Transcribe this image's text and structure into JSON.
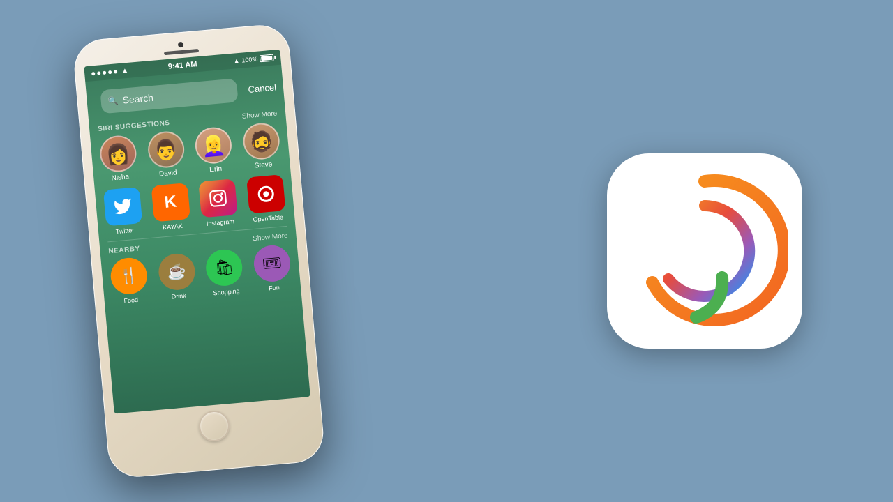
{
  "background_color": "#7a9cb8",
  "phone": {
    "status_bar": {
      "time": "9:41 AM",
      "battery": "100%",
      "signal": "●●●●●",
      "wifi": "WiFi"
    },
    "search": {
      "placeholder": "Search",
      "cancel_label": "Cancel"
    },
    "siri_suggestions": {
      "section_title": "SIRI SUGGESTIONS",
      "show_more": "Show More",
      "contacts": [
        {
          "name": "Nisha",
          "emoji": "👩",
          "bg": "#d4956a"
        },
        {
          "name": "David",
          "emoji": "👨",
          "bg": "#c8a87a"
        },
        {
          "name": "Erin",
          "emoji": "👱‍♀️",
          "bg": "#b8956a"
        },
        {
          "name": "Steve",
          "emoji": "🧔",
          "bg": "#c89870"
        }
      ],
      "apps": [
        {
          "name": "Twitter",
          "icon": "🐦",
          "bg_class": "app-twitter"
        },
        {
          "name": "KAYAK",
          "icon": "K",
          "bg_class": "app-kayak"
        },
        {
          "name": "Instagram",
          "icon": "📷",
          "bg_class": "app-instagram"
        },
        {
          "name": "OpenTable",
          "icon": "🔴",
          "bg_class": "app-opentable"
        }
      ]
    },
    "nearby": {
      "section_title": "NEARBY",
      "show_more": "Show More",
      "items": [
        {
          "name": "Food",
          "icon": "🍴",
          "bg_class": "nearby-food"
        },
        {
          "name": "Drink",
          "icon": "☕",
          "bg_class": "nearby-drink"
        },
        {
          "name": "Shopping",
          "icon": "🛍",
          "bg_class": "nearby-shopping"
        },
        {
          "name": "Fun",
          "icon": "🎟",
          "bg_class": "nearby-fun"
        }
      ]
    }
  },
  "ios9_logo": {
    "number": "9",
    "colors": {
      "arc_outer": "#f7941d",
      "arc_inner_top": "#f7941d",
      "arc_inner_bottom": "#2196f3",
      "tail": "#4caf50"
    }
  }
}
